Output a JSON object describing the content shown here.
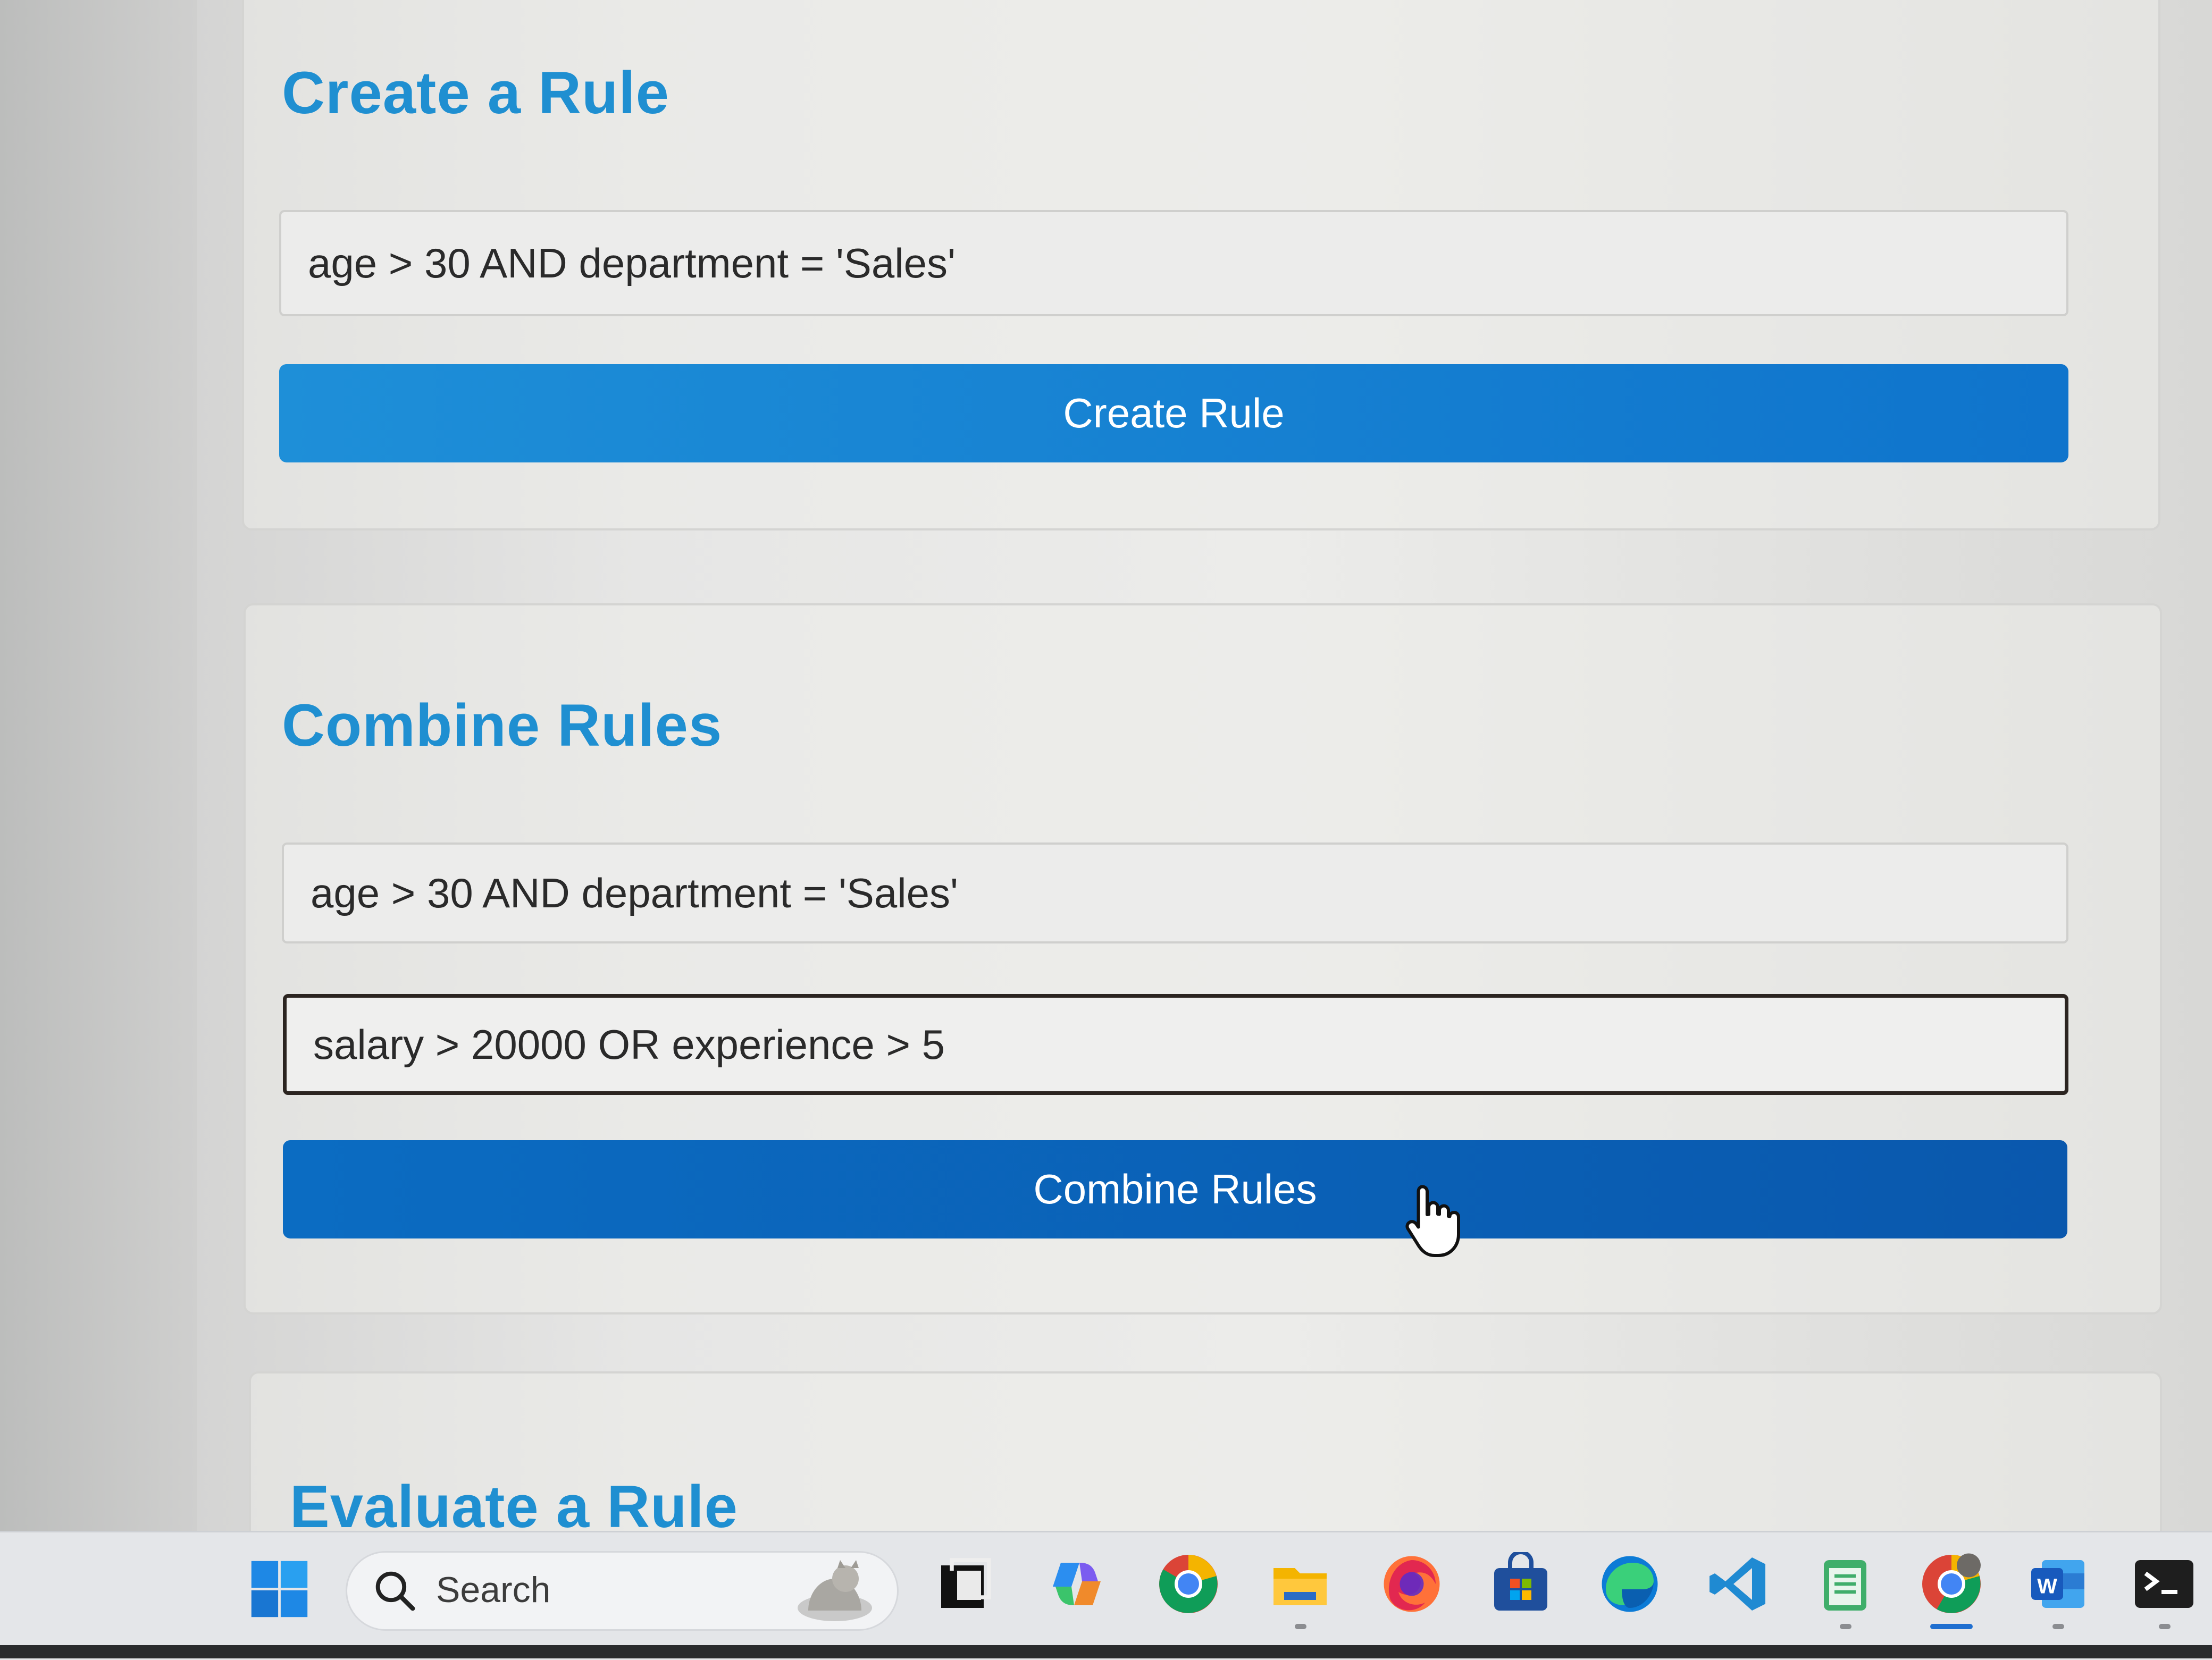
{
  "create_section": {
    "title": "Create a Rule",
    "rule_input_value": "age > 30 AND department = 'Sales'",
    "button_label": "Create Rule"
  },
  "combine_section": {
    "title": "Combine Rules",
    "rule1_value": "age > 30 AND department = 'Sales'",
    "rule2_value": "salary > 20000 OR experience > 5",
    "button_label": "Combine Rules"
  },
  "evaluate_section": {
    "title": "Evaluate a Rule"
  },
  "taskbar": {
    "search_label": "Search",
    "pinned_icons": [
      "start-icon",
      "task-view-icon",
      "copilot-icon",
      "chrome-icon",
      "file-explorer-icon",
      "firefox-icon",
      "microsoft-store-icon",
      "edge-icon",
      "vscode-icon",
      "notepad-icon",
      "chrome-active-icon",
      "word-icon",
      "terminal-icon"
    ]
  },
  "colors": {
    "title_blue": "#1f8fd1",
    "button_blue": "#1e8fd8",
    "button_blue_hover": "#0b6cc2"
  }
}
